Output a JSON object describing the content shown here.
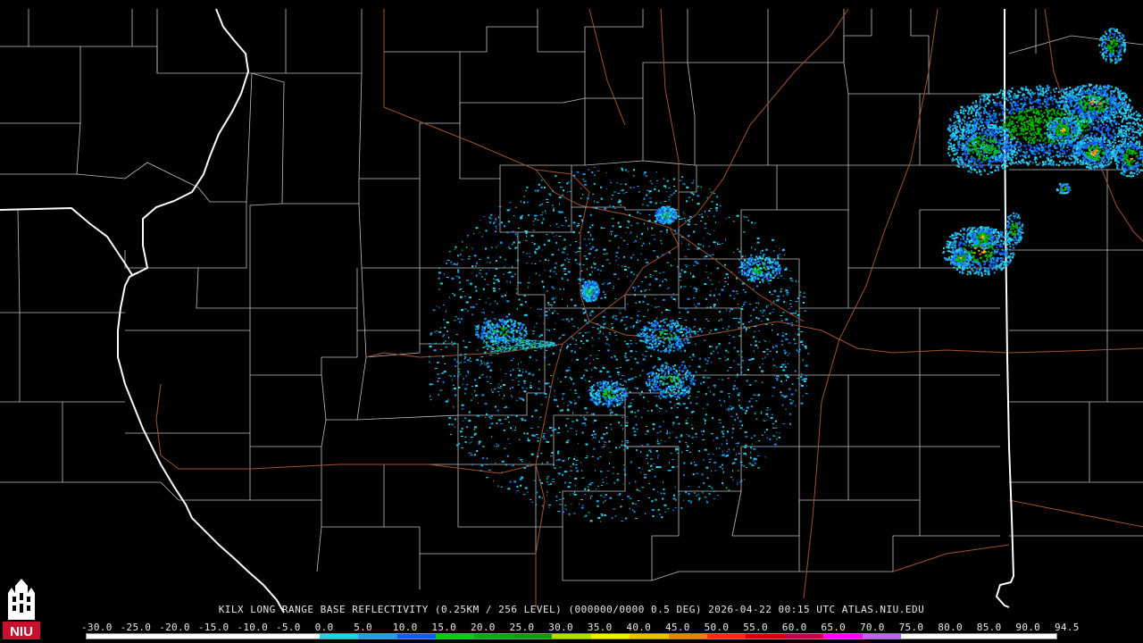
{
  "caption": {
    "text": "KILX LONG RANGE BASE REFLECTIVITY (0.25KM / 256 LEVEL) (000000/0000 0.5 DEG) 2026-04-22 00:15 UTC  ATLAS.NIU.EDU"
  },
  "logo": {
    "text": "NIU",
    "icon": "niu-tower-logo"
  },
  "scale": {
    "labels": [
      "-30.0",
      "-25.0",
      "-20.0",
      "-15.0",
      "-10.0",
      "-5.0",
      "0.0",
      "5.0",
      "10.0",
      "15.0",
      "20.0",
      "25.0",
      "30.0",
      "35.0",
      "40.0",
      "45.0",
      "50.0",
      "55.0",
      "60.0",
      "65.0",
      "70.0",
      "75.0",
      "80.0",
      "85.0",
      "90.0",
      "94.5"
    ],
    "colors": [
      "#ffffff",
      "#ffffff",
      "#ffffff",
      "#ffffff",
      "#ffffff",
      "#ffffff",
      "#22d3e8",
      "#1aa0f0",
      "#1060f0",
      "#00d000",
      "#00b000",
      "#00a000",
      "#b0e000",
      "#f0f000",
      "#f0c000",
      "#f08000",
      "#f03000",
      "#d00000",
      "#c00050",
      "#ff00ff",
      "#c060ff",
      "#ffffff",
      "#ffffff",
      "#ffffff",
      "#ffffff"
    ]
  },
  "map": {
    "background": "#000000",
    "county_line_color": "#cfcfcf",
    "state_line_color": "#ffffff",
    "highway_color": "#a0522d"
  }
}
